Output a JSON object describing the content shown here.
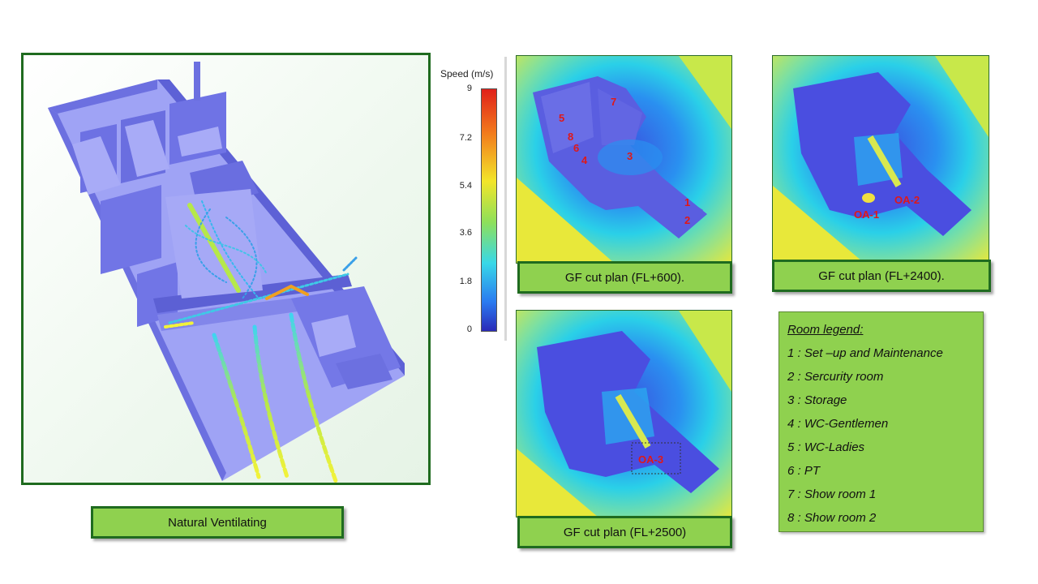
{
  "main_view": {
    "caption": "Natural Ventilating"
  },
  "color_scale": {
    "title": "Speed (m/s)",
    "ticks": [
      "9",
      "7.2",
      "5.4",
      "3.6",
      "1.8",
      "0"
    ]
  },
  "cut_plans": [
    {
      "caption": "GF cut plan (FL+600).",
      "room_numbers": [
        "1",
        "2",
        "3",
        "4",
        "5",
        "6",
        "7",
        "8"
      ]
    },
    {
      "caption": "GF cut plan (FL+2400).",
      "openings": [
        "OA-1",
        "OA-2"
      ]
    },
    {
      "caption": "GF cut plan (FL+2500)",
      "openings": [
        "OA-3"
      ]
    }
  ],
  "room_legend": {
    "title": "Room legend:",
    "items": [
      "1 : Set –up and Maintenance",
      "2 : Sercurity room",
      "3 : Storage",
      "4 : WC-Gentlemen",
      "5 : WC-Ladies",
      "6 : PT",
      "7 : Show room 1",
      "8 : Show room 2"
    ]
  },
  "colors": {
    "building": "#7b7ee8",
    "border": "#1f6b1f",
    "caption_bg": "#8fd14f",
    "label_red": "#e01818"
  }
}
